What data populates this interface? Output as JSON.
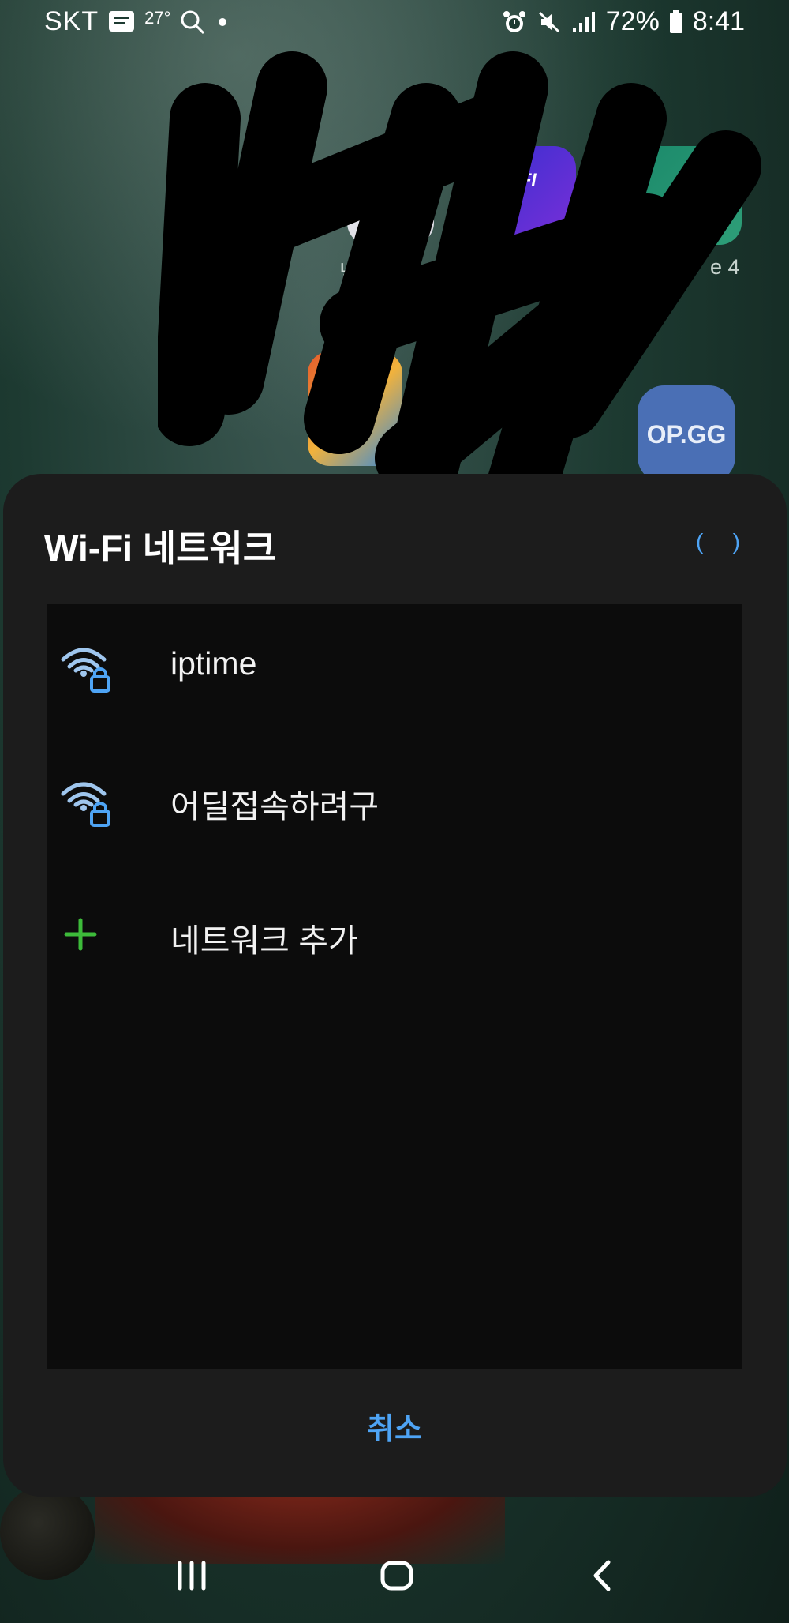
{
  "status_bar": {
    "carrier": "SKT",
    "temperature": "27°",
    "battery_percent": "72%",
    "time": "8:41",
    "icons": [
      "message-icon",
      "search-icon",
      "dot-icon",
      "alarm-icon",
      "mute-icon",
      "signal-icon",
      "battery-icon"
    ]
  },
  "home_screen": {
    "app_labels": [
      "넥슨",
      "F",
      "e 4"
    ],
    "opgg_label": "OP.GG"
  },
  "dialog": {
    "title": "Wi-Fi 네트워크",
    "loading_glyph_left": "(",
    "loading_glyph_right": ")",
    "networks": [
      {
        "name": "iptime",
        "icon": "wifi-lock-icon",
        "secured": true
      },
      {
        "name": "어딜접속하려구",
        "icon": "wifi-lock-icon",
        "secured": true
      }
    ],
    "add_network": {
      "label": "네트워크 추가",
      "icon": "plus-icon"
    },
    "cancel_label": "취소",
    "accent_color": "#4ea4f5",
    "add_color": "#3dbb3a"
  },
  "nav_bar": {
    "buttons": [
      "recents-icon",
      "home-icon",
      "back-icon"
    ]
  }
}
